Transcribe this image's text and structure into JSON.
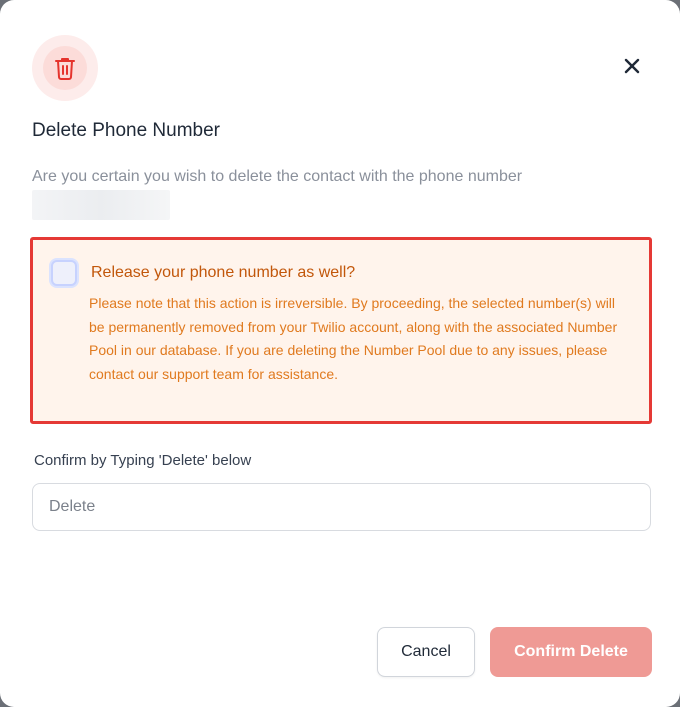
{
  "dialog": {
    "title": "Delete Phone Number",
    "description": "Are you certain you wish to delete the contact with the phone number",
    "icon": "trash-icon",
    "close_icon": "close-icon"
  },
  "warning": {
    "checkbox_checked": false,
    "heading": "Release your phone number as well?",
    "text": "Please note that this action is irreversible. By proceeding, the selected number(s) will be permanently removed from your Twilio account, along with the associated Number Pool in our database. If you are deleting the Number Pool due to any issues, please contact our support team for assistance."
  },
  "confirm": {
    "label": "Confirm by Typing 'Delete' below",
    "placeholder": "Delete",
    "value": ""
  },
  "actions": {
    "cancel_label": "Cancel",
    "confirm_label": "Confirm Delete"
  },
  "colors": {
    "danger": "#e53935",
    "warning_text": "#e07a1f",
    "warning_background": "#fff4ec",
    "confirm_button": "#ef9a95"
  }
}
